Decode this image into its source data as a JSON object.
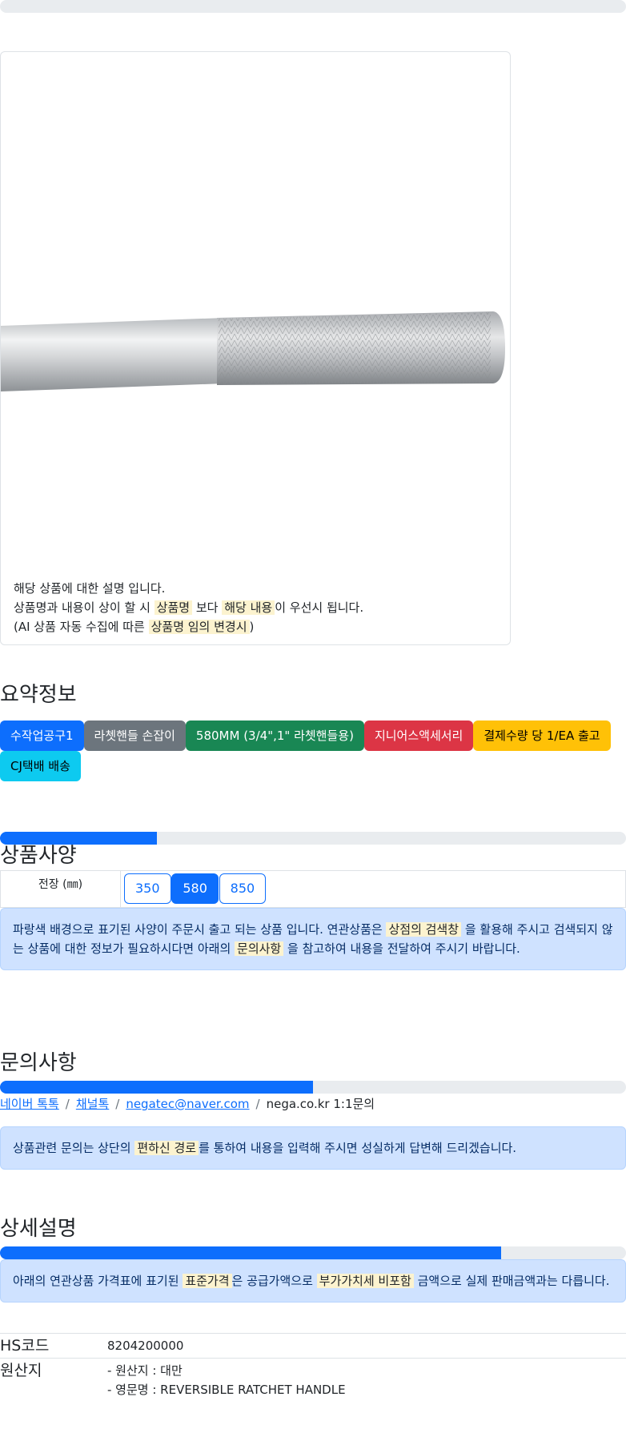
{
  "card": {
    "line1": "해당 상품에 대한 설명 입니다.",
    "line2_pre": "상품명과 내용이 상이 할 시",
    "line2_mark1": "상품명",
    "line2_mid": "보다",
    "line2_mark2": "해당 내용",
    "line2_post": "이 우선시 됩니다.",
    "line3_pre": "(AI 상품 자동 수집에 따른",
    "line3_mark": "상품명 임의 변경시",
    "line3_post": ")"
  },
  "summary": {
    "title": "요약정보",
    "badges": [
      "수작업공구1",
      "라쳇핸들 손잡이",
      "580MM (3/4\",1\" 라쳇핸들용)",
      "지니어스액세서리",
      "결제수량 당 1/EA 출고",
      "CJ택배 배송"
    ]
  },
  "spec": {
    "title": "상품사양",
    "progress": 0.25,
    "label": "전장 (㎜)",
    "options": [
      "350",
      "580",
      "850"
    ],
    "selected": "580",
    "notice_pre": "파랑색 배경으로 표기된 사양이 주문시 출고 되는 상품 입니다. 연관상품은",
    "notice_mark1": "상점의 검색창",
    "notice_mid": "을 활용해 주시고 검색되지 않는 상품에 대한 정보가 필요하시다면 아래의",
    "notice_mark2": "문의사항",
    "notice_post": "을 참고하여 내용을 전달하여 주시기 바랍니다."
  },
  "inquiry": {
    "title": "문의사항",
    "progress": 0.5,
    "links": [
      "네이버 톡톡",
      "채널톡",
      "negatec@naver.com"
    ],
    "plain": "nega.co.kr 1:1문의",
    "notice_pre": "상품관련 문의는 상단의",
    "notice_mark": "편하신 경로",
    "notice_post": "를 통하여 내용을 입력해 주시면 성실하게 답변해 드리겠습니다."
  },
  "detail": {
    "title": "상세설명",
    "progress": 0.8,
    "notice_pre": "아래의 연관상품 가격표에 표기된",
    "notice_mark1": "표준가격",
    "notice_mid": "은 공급가액으로",
    "notice_mark2": "부가가치세 비포함",
    "notice_post": "금액으로 실제 판매금액과는 다릅니다."
  },
  "info": {
    "hs_key": "HS코드",
    "hs_val": "8204200000",
    "origin_key": "원산지",
    "origin_val1": "- 원산지 : 대만",
    "origin_val2": "- 영문명 : REVERSIBLE RATCHET HANDLE"
  },
  "colors": {
    "primary": "#0d6efd",
    "secondary": "#6c757d",
    "success": "#198754",
    "danger": "#dc3545",
    "warning": "#ffc107",
    "info": "#0dcaf0",
    "alert_bg": "#cfe2ff",
    "highlight": "#fcf3cf"
  }
}
